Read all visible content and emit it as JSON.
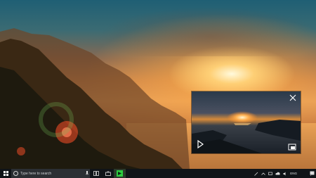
{
  "taskbar": {
    "search_placeholder": "Type here to search",
    "language": "ENG"
  },
  "icons": {
    "start": "windows-logo-icon",
    "search": "search-circle-icon",
    "microphone": "microphone-icon",
    "task_view": "task-view-icon",
    "store": "store-bag-icon",
    "app": "green-app-icon",
    "close": "close-icon",
    "play": "play-icon",
    "expand": "expand-window-icon"
  },
  "colors": {
    "taskbar": "#101418",
    "search_box": "#2b2f33",
    "app_accent": "#2ecc40"
  }
}
